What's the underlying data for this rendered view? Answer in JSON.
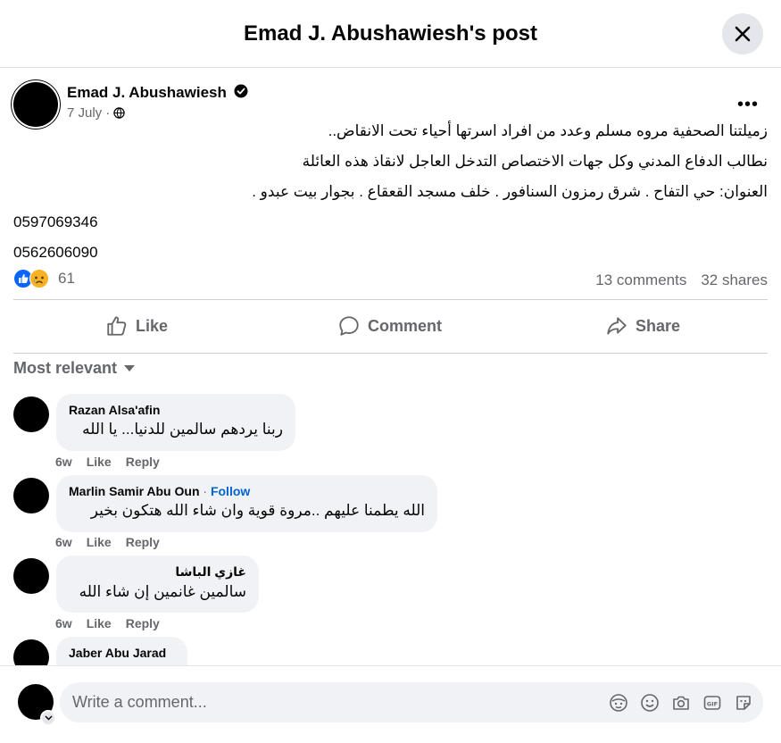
{
  "header": {
    "title": "Emad J. Abushawiesh's post"
  },
  "post": {
    "author": "Emad J. Abushawiesh",
    "date": "7 July",
    "separator": "·",
    "lines": [
      "زميلتنا الصحفية مروه مسلم وعدد من افراد اسرتها  أحياء تحت الانقاض..",
      "نطالب الدفاع المدني وكل جهات الاختصاص التدخل العاجل لانقاذ هذه العائلة",
      "العنوان: حي التفاح  . شرق رمزون السنافور . خلف مسجد القعقاع . بجوار بيت عبدو ."
    ],
    "phones": [
      "0597069346",
      "0562606090"
    ],
    "reaction_count": "61",
    "comments_count": "13 comments",
    "shares_count": "32 shares"
  },
  "actions": {
    "like": "Like",
    "comment": "Comment",
    "share": "Share"
  },
  "sort_label": "Most relevant",
  "comments": [
    {
      "name": "Razan Alsa'afin",
      "text": "ربنا يردهم سالمين للدنيا... يا الله",
      "time": "6w",
      "like": "Like",
      "reply": "Reply"
    },
    {
      "name": "Marlin Samir Abu Oun",
      "follow": "Follow",
      "follow_sep": "·",
      "text": "الله يطمنا عليهم ..مروة قوية وان شاء الله هتكون بخير",
      "time": "6w",
      "like": "Like",
      "reply": "Reply"
    },
    {
      "name": "غازي الباشا",
      "text": "سالمين غانمين إن شاء الله",
      "time": "6w",
      "like": "Like",
      "reply": "Reply"
    },
    {
      "name": "Jaber Abu Jarad",
      "text": ""
    }
  ],
  "composer": {
    "placeholder": "Write a comment..."
  },
  "colors": {
    "accent": "#0866ff",
    "follow": "#0064d1",
    "muted": "#65676b",
    "bubble": "#f0f2f5"
  }
}
